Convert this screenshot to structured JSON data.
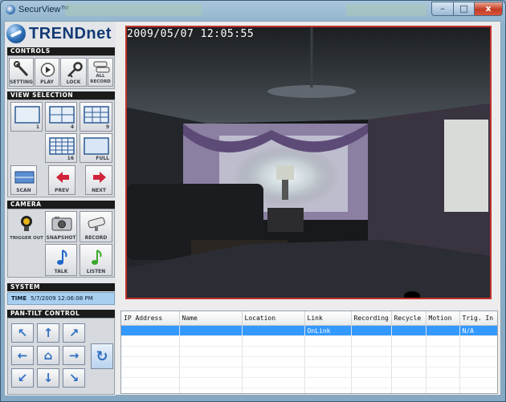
{
  "window": {
    "title": "SecurView™",
    "controls": {
      "minimize": "–",
      "maximize": "□",
      "close": "x"
    }
  },
  "logo": {
    "text": "TRENDnet"
  },
  "controls": {
    "header": "CONTROLS",
    "buttons": [
      {
        "label": "SETTING",
        "icon": "wrench-icon"
      },
      {
        "label": "PLAY",
        "icon": "play-icon"
      },
      {
        "label": "LOCK",
        "icon": "key-icon"
      },
      {
        "label": "ALL RECORD",
        "icon": "cameras-icon"
      }
    ]
  },
  "view_selection": {
    "header": "VIEW SELECTION",
    "layouts": [
      "1",
      "4",
      "9",
      "16",
      "FULL"
    ],
    "nav": [
      {
        "label": "SCAN",
        "icon": "scan-icon"
      },
      {
        "label": "PREV",
        "icon": "arrow-left-icon"
      },
      {
        "label": "NEXT",
        "icon": "arrow-right-icon"
      }
    ]
  },
  "camera": {
    "header": "CAMERA",
    "buttons": [
      {
        "label": "TRIGGER OUT",
        "icon": "trigger-icon"
      },
      {
        "label": "SNAPSHOT",
        "icon": "snapshot-icon"
      },
      {
        "label": "RECORD",
        "icon": "camera-record-icon"
      },
      {
        "label": "TALK",
        "icon": "music-note-blue-icon"
      },
      {
        "label": "LISTEN",
        "icon": "music-note-green-icon"
      }
    ]
  },
  "system": {
    "header": "SYSTEM",
    "time_label": "TIME",
    "time_value": "5/7/2009 12:06:08 PM"
  },
  "pan_tilt": {
    "header": "PAN-TILT CONTROL"
  },
  "video": {
    "timestamp": "2009/05/07  12:05:55"
  },
  "device_list": {
    "columns": [
      "IP Address",
      "Name",
      "Location",
      "Link",
      "Recording",
      "Recycle",
      "Motion",
      "Trig. In"
    ],
    "rows": [
      [
        "",
        "",
        "",
        "OnLink",
        "",
        "",
        "",
        "N/A"
      ]
    ]
  },
  "colors": {
    "accent": "#3399ff",
    "video_border": "#c0322b",
    "header_bg": "#1b1b1b"
  }
}
